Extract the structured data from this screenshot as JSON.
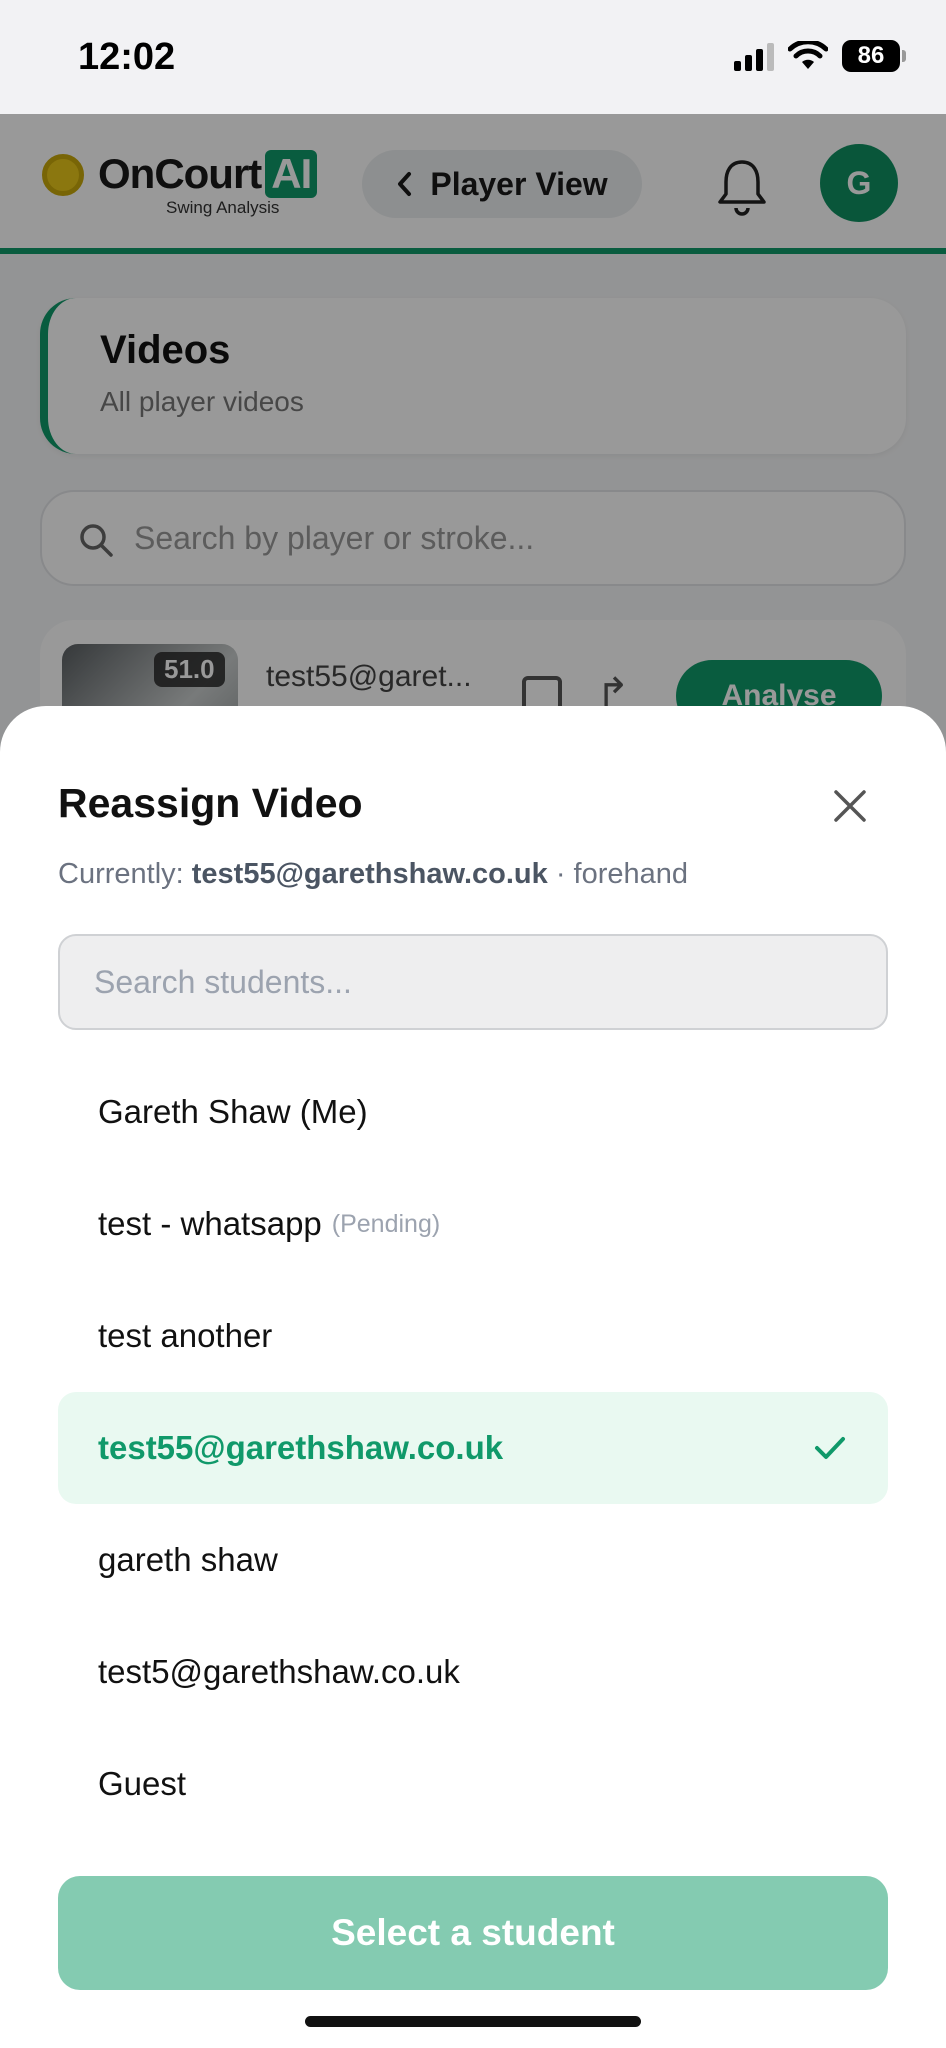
{
  "status_bar": {
    "time": "12:02",
    "battery": "86"
  },
  "app": {
    "brand": "OnCourt",
    "brand_ai": "AI",
    "brand_sub": "Swing Analysis",
    "nav_back_label": "Player View",
    "avatar_initial": "G",
    "videos_title": "Videos",
    "videos_subtitle": "All player videos",
    "search_placeholder": "Search by player or stroke...",
    "video_row": {
      "duration_badge": "51.0",
      "email": "test55@garet...",
      "action_label": "Analyse"
    },
    "accent_color": "#10996a"
  },
  "sheet": {
    "title": "Reassign Video",
    "current_prefix": "Currently:",
    "current_email": "test55@garethshaw.co.uk",
    "current_stroke": "· forehand",
    "search_placeholder": "Search students...",
    "students": [
      {
        "name": "Gareth Shaw (Me)",
        "tag": "",
        "selected": false
      },
      {
        "name": "test - whatsapp",
        "tag": "(Pending)",
        "selected": false
      },
      {
        "name": "test another",
        "tag": "",
        "selected": false
      },
      {
        "name": "test55@garethshaw.co.uk",
        "tag": "",
        "selected": true
      },
      {
        "name": "gareth shaw",
        "tag": "",
        "selected": false
      },
      {
        "name": "test5@garethshaw.co.uk",
        "tag": "",
        "selected": false
      },
      {
        "name": "Guest",
        "tag": "",
        "selected": false
      }
    ],
    "submit_label": "Select a student",
    "submit_color": "#84cbb1",
    "selected_bg": "#e9f9f1"
  }
}
